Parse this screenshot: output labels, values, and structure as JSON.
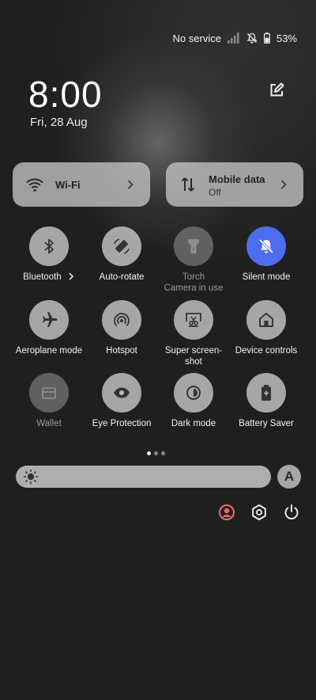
{
  "status_bar": {
    "network_text": "No service",
    "battery_text": "53%",
    "battery_level": 0.53,
    "icons": [
      "signal-icon",
      "silent-bell-icon",
      "battery-icon"
    ]
  },
  "clock": {
    "time": "8:00",
    "date": "Fri, 28 Aug"
  },
  "big_tiles": [
    {
      "label": "Wi-Fi",
      "icon": "wifi-icon"
    },
    {
      "label": "Mobile data",
      "sublabel": "Off",
      "icon": "mobile-data-icon"
    }
  ],
  "toggles": [
    {
      "label": "Bluetooth",
      "icon": "bluetooth-icon",
      "has_chevron": true
    },
    {
      "label": "Auto-rotate",
      "icon": "auto-rotate-icon"
    },
    {
      "label": "Torch",
      "sublabel": "Camera in use",
      "icon": "torch-icon",
      "disabled": true
    },
    {
      "label": "Silent mode",
      "icon": "silent-bell-icon",
      "active": true
    },
    {
      "label": "Aeroplane mode",
      "icon": "airplane-icon"
    },
    {
      "label": "Hotspot",
      "icon": "hotspot-icon"
    },
    {
      "label": "Super screen-\nshot",
      "icon": "screenshot-icon"
    },
    {
      "label": "Device controls",
      "icon": "home-icon"
    },
    {
      "label": "Wallet",
      "icon": "wallet-icon",
      "disabled": true
    },
    {
      "label": "Eye Protection",
      "icon": "eye-icon"
    },
    {
      "label": "Dark mode",
      "icon": "dark-mode-icon"
    },
    {
      "label": "Battery Saver",
      "icon": "battery-saver-icon"
    }
  ],
  "pagination": {
    "pages": 3,
    "current": 1
  },
  "brightness": {
    "auto_label": "A",
    "icon": "sun-icon"
  },
  "footer": {
    "icons": [
      "user-icon",
      "settings-icon",
      "power-icon"
    ],
    "accent": "#f06a6a"
  },
  "colors": {
    "active": "#4d6df0",
    "tile": "#c4c4c4"
  }
}
